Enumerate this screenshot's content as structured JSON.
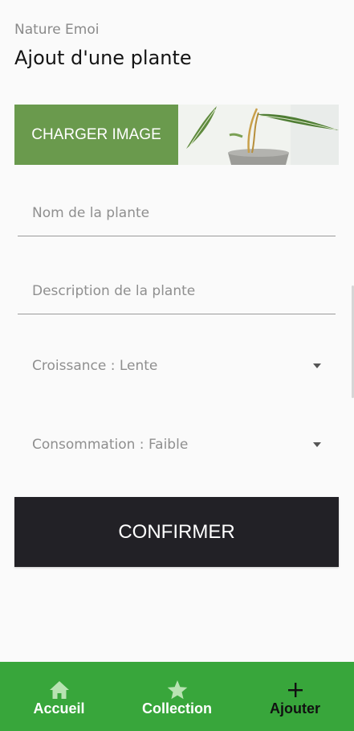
{
  "header": {
    "app_name": "Nature Emoi",
    "title": "Ajout d'une plante"
  },
  "upload": {
    "button_label": "CHARGER IMAGE"
  },
  "form": {
    "name_placeholder": "Nom de la plante",
    "description_placeholder": "Description de la plante",
    "growth_select": "Croissance : Lente",
    "consumption_select": "Consommation : Faible",
    "confirm_label": "CONFIRMER"
  },
  "nav": {
    "items": [
      {
        "label": "Accueil",
        "icon": "home-icon"
      },
      {
        "label": "Collection",
        "icon": "star-icon"
      },
      {
        "label": "Ajouter",
        "icon": "plus-icon"
      }
    ],
    "active_index": 2
  },
  "colors": {
    "upload_button": "#6a9a4d",
    "confirm_button": "#222126",
    "nav_bar": "#38a63b",
    "nav_active_label": "#111111"
  }
}
